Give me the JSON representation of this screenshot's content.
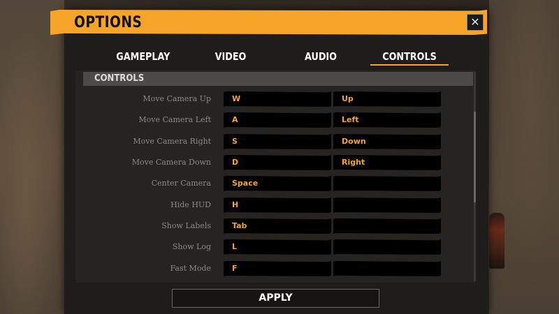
{
  "window": {
    "title": "OPTIONS",
    "close_label": "✕"
  },
  "tabs": [
    {
      "label": "GAMEPLAY",
      "active": false
    },
    {
      "label": "VIDEO",
      "active": false
    },
    {
      "label": "AUDIO",
      "active": false
    },
    {
      "label": "CONTROLS",
      "active": true
    }
  ],
  "section": {
    "title": "CONTROLS"
  },
  "bindings": [
    {
      "action": "Move Camera Up",
      "primary": "W",
      "secondary": "Up"
    },
    {
      "action": "Move Camera Left",
      "primary": "A",
      "secondary": "Left"
    },
    {
      "action": "Move Camera Right",
      "primary": "S",
      "secondary": "Down"
    },
    {
      "action": "Move Camera Down",
      "primary": "D",
      "secondary": "Right"
    },
    {
      "action": "Center Camera",
      "primary": "Space",
      "secondary": ""
    },
    {
      "action": "Hide HUD",
      "primary": "H",
      "secondary": ""
    },
    {
      "action": "Show Labels",
      "primary": "Tab",
      "secondary": ""
    },
    {
      "action": "Show Log",
      "primary": "L",
      "secondary": ""
    },
    {
      "action": "Fast Mode",
      "primary": "F",
      "secondary": ""
    }
  ],
  "apply_label": "APPLY",
  "colors": {
    "accent": "#f7a52a",
    "panel": "#1f1d1c",
    "key_bg": "#000000"
  }
}
